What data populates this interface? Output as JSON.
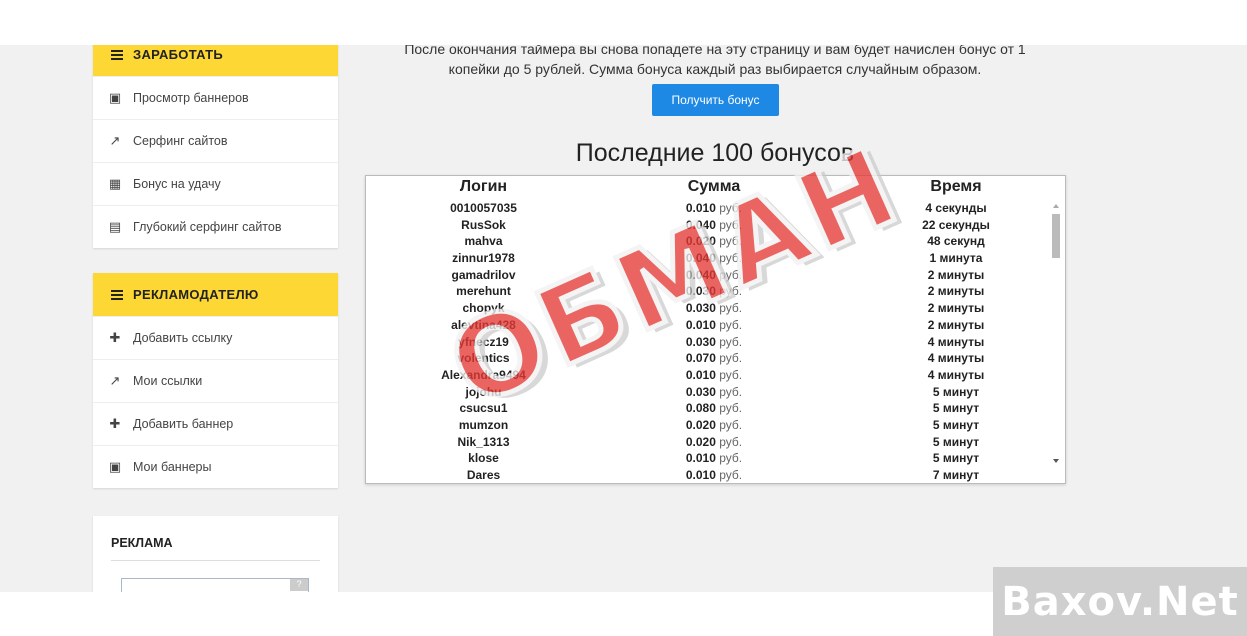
{
  "sidebar": {
    "earn": {
      "title": "ЗАРАБОТАТЬ",
      "items": [
        {
          "label": "Просмотр баннеров",
          "icon": "image-icon"
        },
        {
          "label": "Серфинг сайтов",
          "icon": "external-link-icon"
        },
        {
          "label": "Бонус на удачу",
          "icon": "gift-icon"
        },
        {
          "label": "Глубокий серфинг сайтов",
          "icon": "film-icon"
        }
      ]
    },
    "advertiser": {
      "title": "РЕКЛАМОДАТЕЛЮ",
      "items": [
        {
          "label": "Добавить ссылку",
          "icon": "plus-icon"
        },
        {
          "label": "Мои ссылки",
          "icon": "external-link-icon"
        },
        {
          "label": "Добавить баннер",
          "icon": "plus-icon"
        },
        {
          "label": "Мои баннеры",
          "icon": "image-icon"
        }
      ]
    },
    "ads": {
      "title": "РЕКЛАМА"
    }
  },
  "main": {
    "intro_line1": "После окончания таймера вы снова попадете на эту страницу и вам будет начислен бонус от 1",
    "intro_line2": "копейки до 5 рублей. Сумма бонуса каждый раз выбирается случайным образом.",
    "bonus_button": "Получить бонус",
    "section_title": "Последние 100 бонусов",
    "table": {
      "headers": [
        "Логин",
        "Сумма",
        "Время"
      ],
      "currency": "руб.",
      "rows": [
        {
          "login": "0010057035",
          "amount": "0.010",
          "time": "4 секунды"
        },
        {
          "login": "RusSok",
          "amount": "0.040",
          "time": "22 секунды"
        },
        {
          "login": "mahva",
          "amount": "0.020",
          "time": "48 секунд"
        },
        {
          "login": "zinnur1978",
          "amount": "0.040",
          "time": "1 минута"
        },
        {
          "login": "gamadrilov",
          "amount": "0.040",
          "time": "2 минуты"
        },
        {
          "login": "merehunt",
          "amount": "0.030",
          "time": "2 минуты"
        },
        {
          "login": "chopyk",
          "amount": "0.030",
          "time": "2 минуты"
        },
        {
          "login": "alevtina428",
          "amount": "0.010",
          "time": "2 минуты"
        },
        {
          "login": "yfnecz19",
          "amount": "0.030",
          "time": "4 минуты"
        },
        {
          "login": "volentics",
          "amount": "0.070",
          "time": "4 минуты"
        },
        {
          "login": "Alexandra9494",
          "amount": "0.010",
          "time": "4 минуты"
        },
        {
          "login": "jojohu",
          "amount": "0.030",
          "time": "5 минут"
        },
        {
          "login": "csucsu1",
          "amount": "0.080",
          "time": "5 минут"
        },
        {
          "login": "mumzon",
          "amount": "0.020",
          "time": "5 минут"
        },
        {
          "login": "Nik_1313",
          "amount": "0.020",
          "time": "5 минут"
        },
        {
          "login": "klose",
          "amount": "0.010",
          "time": "5 минут"
        },
        {
          "login": "Dares",
          "amount": "0.010",
          "time": "7 минут"
        }
      ]
    }
  },
  "overlay": {
    "stamp": "ОБМАН",
    "watermark": "Baxov.Net"
  },
  "colors": {
    "accent_yellow": "#fdd835",
    "button_blue": "#1e88e5",
    "stamp_red": "#e53935"
  }
}
